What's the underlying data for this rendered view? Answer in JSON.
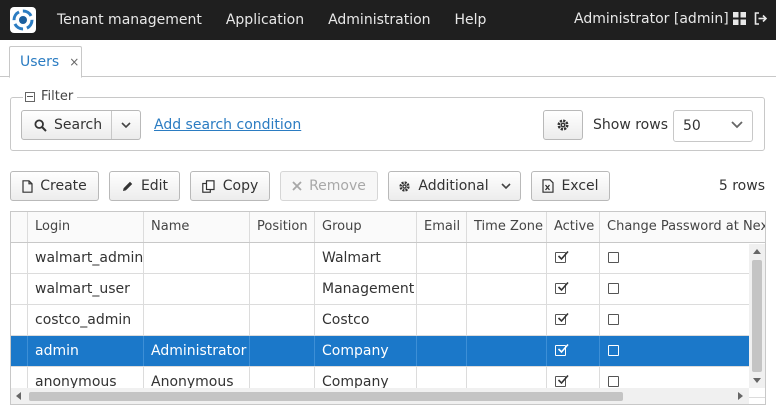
{
  "menu": {
    "items": [
      "Tenant management",
      "Application",
      "Administration",
      "Help"
    ],
    "user": "Administrator [admin]"
  },
  "tabs": [
    {
      "label": "Users",
      "close": "×"
    }
  ],
  "filter": {
    "legend": "Filter",
    "search_label": "Search",
    "add_condition": "Add search condition",
    "show_rows_label": "Show rows",
    "show_rows_value": "50"
  },
  "toolbar": {
    "create": "Create",
    "edit": "Edit",
    "copy": "Copy",
    "remove": "Remove",
    "additional": "Additional",
    "excel": "Excel",
    "row_count": "5 rows"
  },
  "table": {
    "columns": [
      "Login",
      "Name",
      "Position",
      "Group",
      "Email",
      "Time Zone",
      "Active",
      "Change Password at Next"
    ],
    "rows": [
      {
        "login": "walmart_admin",
        "name": "",
        "position": "",
        "group": "Walmart",
        "email": "",
        "timezone": "",
        "active": true,
        "change_pw": false
      },
      {
        "login": "walmart_user",
        "name": "",
        "position": "",
        "group": "Management",
        "email": "",
        "timezone": "",
        "active": true,
        "change_pw": false
      },
      {
        "login": "costco_admin",
        "name": "",
        "position": "",
        "group": "Costco",
        "email": "",
        "timezone": "",
        "active": true,
        "change_pw": false
      },
      {
        "login": "admin",
        "name": "Administrator",
        "position": "",
        "group": "Company",
        "email": "",
        "timezone": "",
        "active": true,
        "change_pw": false
      },
      {
        "login": "anonymous",
        "name": "Anonymous",
        "position": "",
        "group": "Company",
        "email": "",
        "timezone": "",
        "active": true,
        "change_pw": false
      }
    ],
    "selected_index": 3
  },
  "colors": {
    "topbar": "#1f1f1f",
    "accent": "#2b7cc2",
    "selection": "#1b78c9"
  },
  "icons": {
    "logo": "app-logo-icon",
    "layout": "grid-layout-icon",
    "logout": "logout-icon",
    "search": "search-icon",
    "settings": "gear-icon",
    "create": "file-icon",
    "edit": "pencil-icon",
    "copy": "copy-icon",
    "remove": "close-icon",
    "excel": "excel-icon"
  }
}
